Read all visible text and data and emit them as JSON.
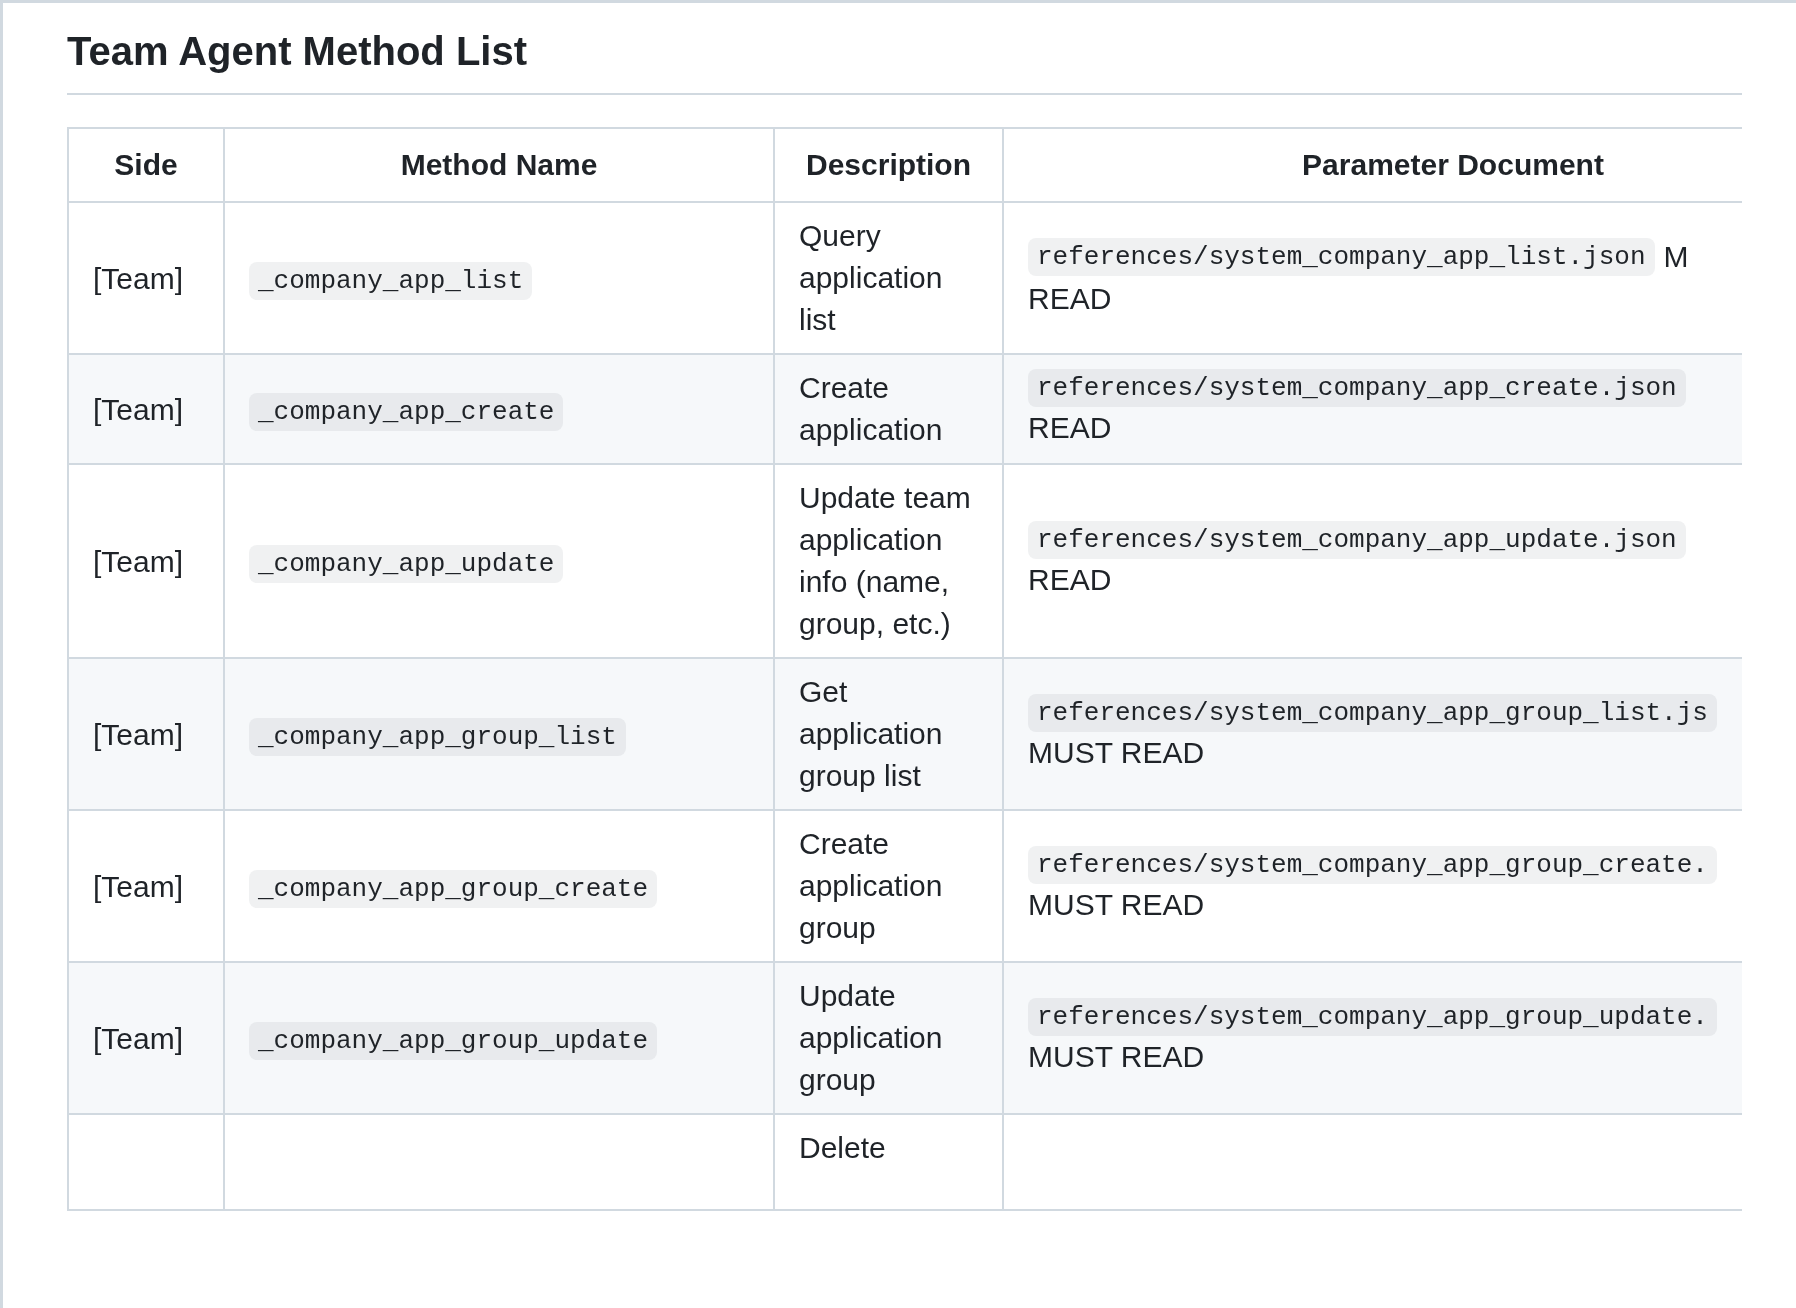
{
  "heading": "Team Agent Method List",
  "table": {
    "columns": [
      "Side",
      "Method Name",
      "Description",
      "Parameter Document"
    ],
    "rows": [
      {
        "side": "[Team]",
        "method": "_company_app_list",
        "description": "Query application list",
        "param": {
          "code": "references/system_company_app_list.json",
          "after": "M",
          "note": "READ"
        }
      },
      {
        "side": "[Team]",
        "method": "_company_app_create",
        "description": "Create application",
        "param": {
          "code": "references/system_company_app_create.json",
          "note": "READ"
        }
      },
      {
        "side": "[Team]",
        "method": "_company_app_update",
        "description": "Update team application info (name, group, etc.)",
        "param": {
          "code": "references/system_company_app_update.json",
          "note": "READ"
        }
      },
      {
        "side": "[Team]",
        "method": "_company_app_group_list",
        "description": "Get application group list",
        "param": {
          "code": "references/system_company_app_group_list.js",
          "note": "MUST READ"
        }
      },
      {
        "side": "[Team]",
        "method": "_company_app_group_create",
        "description": "Create application group",
        "param": {
          "code": "references/system_company_app_group_create.",
          "note": "MUST READ"
        }
      },
      {
        "side": "[Team]",
        "method": "_company_app_group_update",
        "description": "Update application group",
        "param": {
          "code": "references/system_company_app_group_update.",
          "note": "MUST READ"
        }
      },
      {
        "description": "Delete"
      }
    ]
  }
}
